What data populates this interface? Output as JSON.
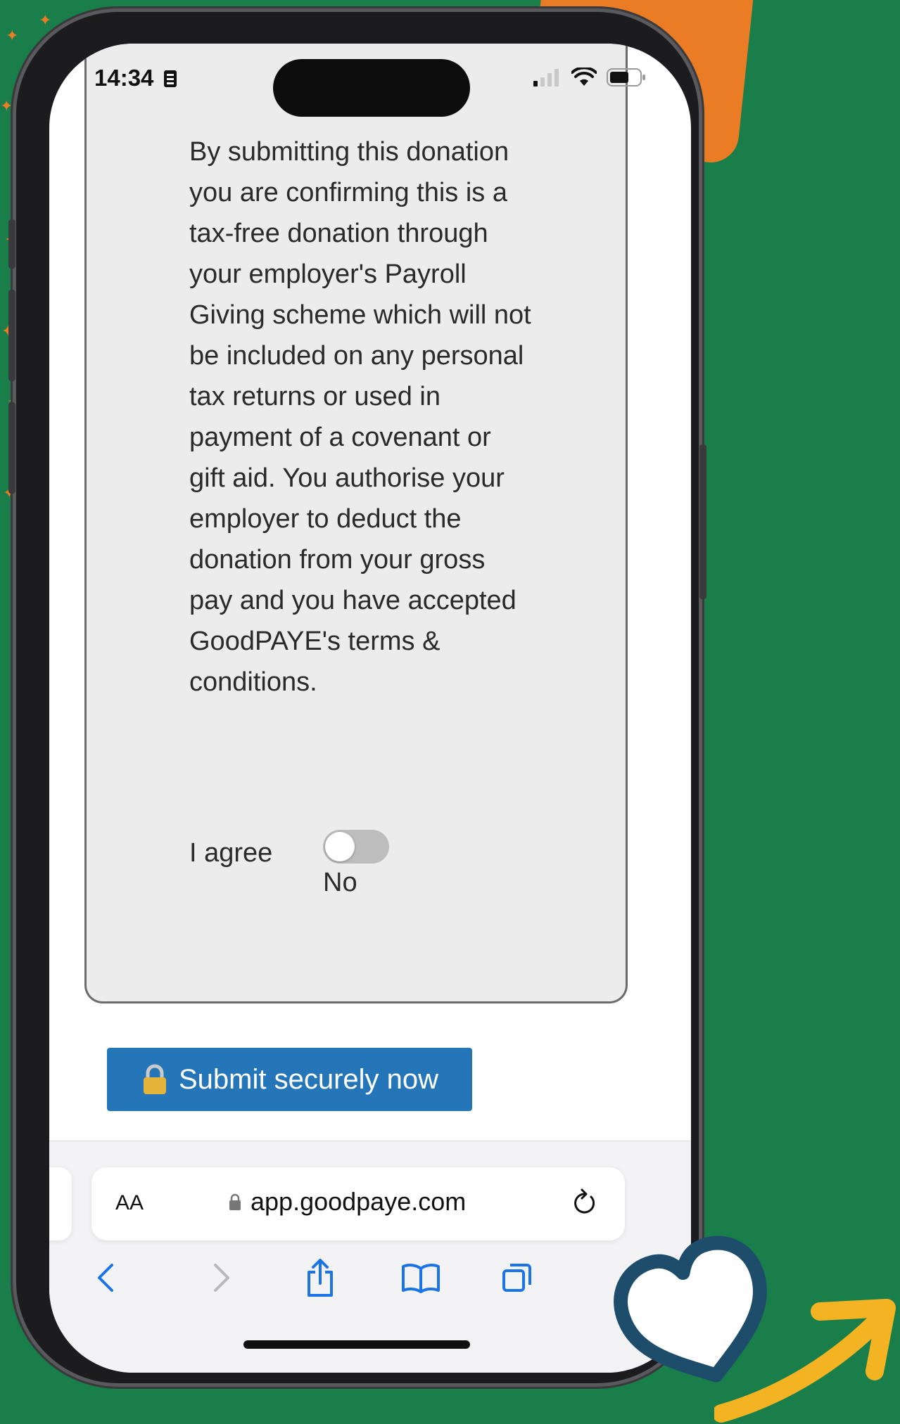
{
  "status_bar": {
    "time": "14:34"
  },
  "consent": {
    "text": "By submitting this donation you are confirming this is a tax-free donation through your employer's Payroll Giving scheme which will not be included on any personal tax returns or used in payment of a covenant or gift aid. You authorise your employer to deduct the donation from your gross pay and you have accepted GoodPAYE's terms & conditions.",
    "agree_label": "I agree",
    "toggle_state": "No",
    "toggle_on": false
  },
  "submit": {
    "label": "Submit securely now",
    "icon": "lock-icon"
  },
  "browser": {
    "text_size_label": "AA",
    "url": "app.goodpaye.com",
    "toolbar_icons": [
      "back-icon",
      "forward-icon",
      "share-icon",
      "bookmarks-icon",
      "tabs-icon"
    ]
  },
  "colors": {
    "background": "#197e4a",
    "accent_orange": "#e97c24",
    "button_blue": "#2576b8",
    "heart_outline": "#1e4d6b",
    "arrow_yellow": "#f3b323"
  }
}
